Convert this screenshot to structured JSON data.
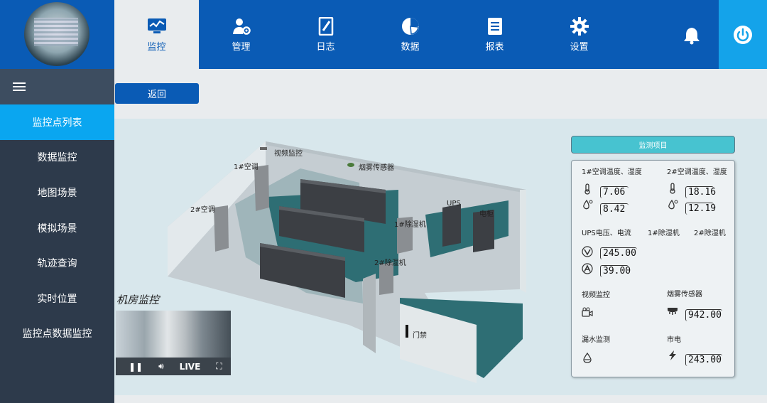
{
  "nav": {
    "items": [
      {
        "label": "监控",
        "icon": "monitor-icon"
      },
      {
        "label": "管理",
        "icon": "user-gear-icon"
      },
      {
        "label": "日志",
        "icon": "notebook-icon"
      },
      {
        "label": "数据",
        "icon": "pie-chart-icon"
      },
      {
        "label": "报表",
        "icon": "document-icon"
      },
      {
        "label": "设置",
        "icon": "gear-icon"
      }
    ],
    "active": "监控"
  },
  "sidebar": {
    "items": [
      {
        "label": "监控点列表"
      },
      {
        "label": "数据监控"
      },
      {
        "label": "地图场景"
      },
      {
        "label": "模拟场景"
      },
      {
        "label": "轨迹查询"
      },
      {
        "label": "实时位置"
      },
      {
        "label": "监控点数据监控"
      }
    ],
    "active": "监控点列表"
  },
  "back_label": "返回",
  "scene_labels": {
    "camera": "视频监控",
    "ac1": "1#空调",
    "ac2": "2#空调",
    "smoke": "烟雾传感器",
    "ups": "UPS",
    "cabinet": "电柜",
    "dehum1": "1#除湿机",
    "dehum2": "2#除湿机",
    "door": "门禁"
  },
  "video": {
    "title": "机房监控",
    "live": "LIVE"
  },
  "monitor": {
    "header": "监测项目",
    "ac1_title": "1#空调温度、湿度",
    "ac2_title": "2#空调温度、湿度",
    "ac1_temp": "7.06",
    "ac1_hum": "8.42",
    "ac2_temp": "18.16",
    "ac2_hum": "12.19",
    "ups_title": "UPS电压、电流",
    "dehum1_title": "1#除湿机",
    "dehum2_title": "2#除湿机",
    "ups_voltage": "245.00",
    "ups_current": "39.00",
    "video_title": "视频监控",
    "smoke_title": "烟雾传感器",
    "smoke_value": "942.00",
    "leak_title": "漏水监测",
    "power_title": "市电",
    "power_value": "243.00"
  },
  "colors": {
    "primary": "#0a5bb5",
    "active_menu": "#0aa6f0",
    "sidebar": "#2d3a4b",
    "panel_header": "#47c3d0"
  }
}
